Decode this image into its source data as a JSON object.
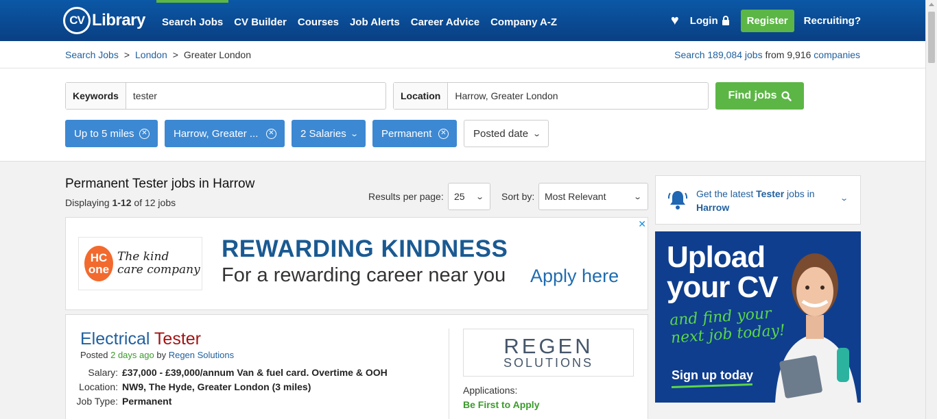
{
  "nav": {
    "logo_cv": "CV",
    "logo_library": "Library",
    "links": [
      "Search Jobs",
      "CV Builder",
      "Courses",
      "Job Alerts",
      "Career Advice",
      "Company A-Z"
    ],
    "login": "Login",
    "register": "Register",
    "recruiting": "Recruiting?"
  },
  "breadcrumb": {
    "items": [
      "Search Jobs",
      "London",
      "Greater London"
    ],
    "sep": ">"
  },
  "jobcount": {
    "prefix": "Search",
    "jobs": "189,084 jobs",
    "mid": "from",
    "companies_num": "9,916",
    "companies": "companies"
  },
  "search": {
    "keywords_label": "Keywords",
    "keywords_value": "tester",
    "location_label": "Location",
    "location_value": "Harrow, Greater London",
    "find_label": "Find jobs"
  },
  "filters": {
    "distance": "Up to 5 miles",
    "location": "Harrow, Greater ...",
    "salaries": "2 Salaries",
    "type": "Permanent",
    "posted": "Posted date"
  },
  "results": {
    "title": "Permanent Tester jobs in Harrow",
    "displaying_prefix": "Displaying",
    "displaying_range": "1-12",
    "displaying_suffix": "of 12 jobs",
    "per_page_label": "Results per page:",
    "per_page_value": "25",
    "sort_label": "Sort by:",
    "sort_value": "Most Relevant"
  },
  "ad": {
    "logo_hc": "HC",
    "logo_one": "one",
    "logo_text1": "The kind",
    "logo_text2": "care company",
    "headline": "REWARDING KINDNESS",
    "sub": "For a rewarding career near you",
    "apply": "Apply here",
    "close": "✕"
  },
  "job": {
    "title_a": "Electrical ",
    "title_b": "Tester",
    "posted_prefix": "Posted",
    "posted_ago": "2 days ago",
    "posted_by": "by",
    "company": "Regen Solutions",
    "salary_label": "Salary:",
    "salary_value": "£37,000 - £39,000/annum Van & fuel card. Overtime & OOH",
    "location_label": "Location:",
    "location_value": "NW9, The Hyde, Greater London (3 miles)",
    "type_label": "Job Type:",
    "type_value": "Permanent",
    "logo_1": "REGEN",
    "logo_2": "SOLUTIONS",
    "apps_label": "Applications:",
    "apps_value": "Be First to Apply"
  },
  "alert": {
    "pre": "Get the latest",
    "kw": "Tester",
    "mid": "jobs in",
    "loc": "Harrow"
  },
  "cvad": {
    "line1": "Upload",
    "line2": "your CV",
    "find1": "and find your",
    "find2": "next job today!",
    "signup": "Sign up today"
  },
  "colors": {
    "brand_blue": "#0b58a6",
    "accent_green": "#5cb646",
    "chip_blue": "#3d88d2",
    "link": "#1f5f9e"
  }
}
